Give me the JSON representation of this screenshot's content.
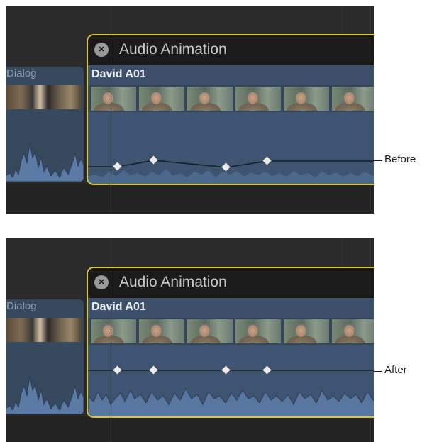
{
  "panels": [
    {
      "id": "before",
      "dialog_label": "Dialog",
      "editor_title": "Audio Animation",
      "close_icon": "x-circle-icon",
      "clip_label": "David A01",
      "callout": "Before"
    },
    {
      "id": "after",
      "dialog_label": "Dialog",
      "editor_title": "Audio Animation",
      "close_icon": "x-circle-icon",
      "clip_label": "David A01",
      "callout": "After"
    }
  ],
  "colors": {
    "accent_yellow": "#d8c837",
    "clip_blue": "#3c5069",
    "timeline_bg": "#2b2b2b"
  }
}
